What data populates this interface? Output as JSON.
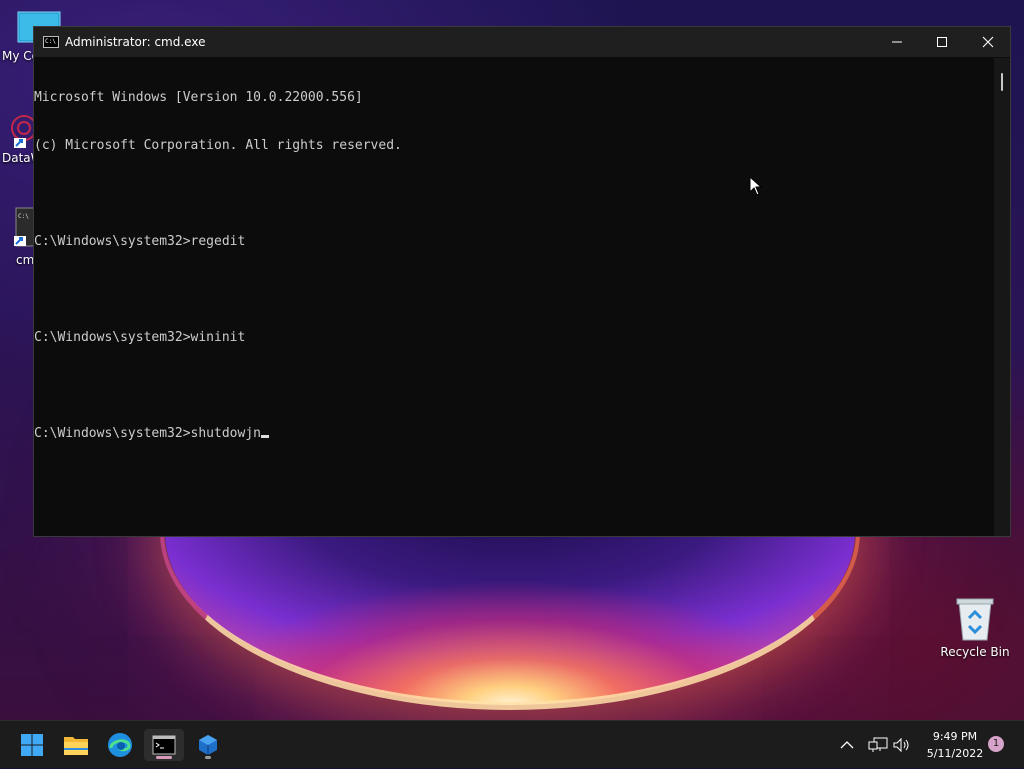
{
  "desktop": {
    "icons": [
      {
        "label": "My Co"
      },
      {
        "label": "DataW"
      },
      {
        "label": "cm"
      },
      {
        "label": "Recycle Bin"
      }
    ]
  },
  "window": {
    "title": "Administrator: cmd.exe",
    "icon_text": "C:\\",
    "console_lines": [
      "Microsoft Windows [Version 10.0.22000.556]",
      "(c) Microsoft Corporation. All rights reserved.",
      "",
      "C:\\Windows\\system32>regedit",
      "",
      "C:\\Windows\\system32>wininit",
      "",
      "C:\\Windows\\system32>shutdowjn"
    ]
  },
  "taskbar": {
    "apps": [
      {
        "name": "start-button"
      },
      {
        "name": "file-explorer"
      },
      {
        "name": "microsoft-edge"
      },
      {
        "name": "command-prompt"
      },
      {
        "name": "app"
      }
    ],
    "clock_time": "9:49 PM",
    "clock_date": "5/11/2022",
    "notification_count": "1"
  },
  "colors": {
    "console_bg": "#0c0c0c",
    "console_text": "#cccccc",
    "titlebar": "#1f1f1f",
    "taskbar": "#1c1c1c",
    "accent": "#0078d4"
  }
}
